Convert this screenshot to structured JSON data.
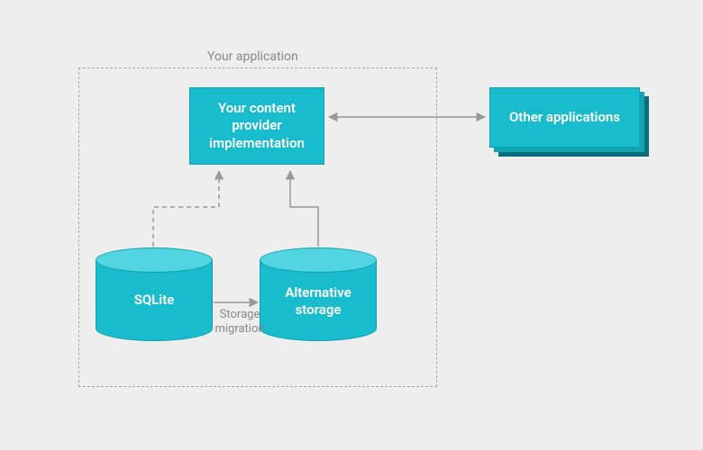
{
  "container": {
    "label": "Your application"
  },
  "nodes": {
    "content_provider": "Your content\nprovider\nimplementation",
    "sqlite": "SQLite",
    "alt_storage": "Alternative\nstorage",
    "other_apps": "Other applications"
  },
  "edges": {
    "storage_migration": "Storage\nmigration"
  },
  "colors": {
    "accent": "#18bccc",
    "accent_light": "#53d5e1",
    "accent_dark": "#0d6d78",
    "bg": "#eeeeee",
    "line": "#999999"
  }
}
